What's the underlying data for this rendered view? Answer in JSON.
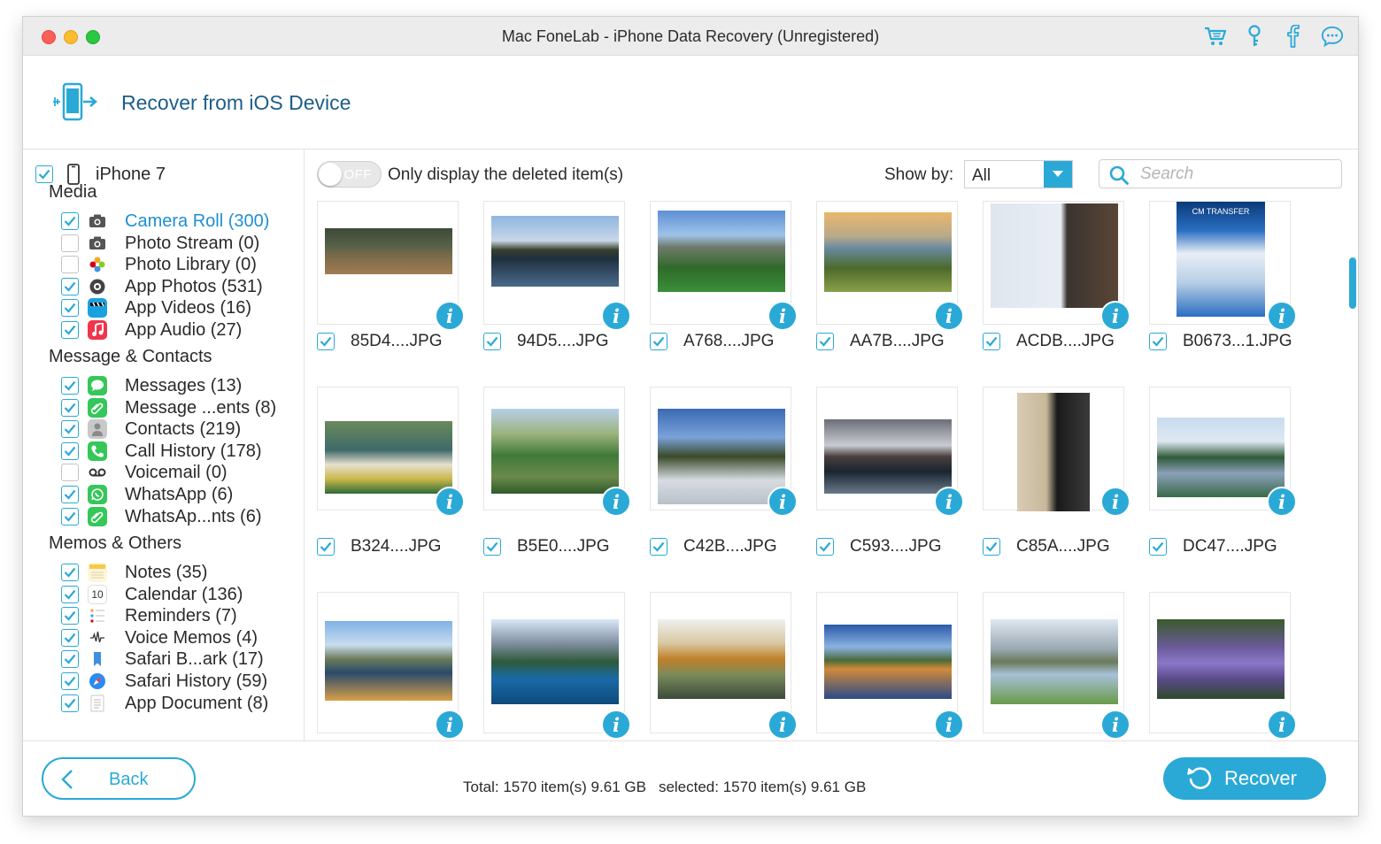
{
  "window": {
    "title": "Mac FoneLab - iPhone Data Recovery (Unregistered)",
    "toolbar_icons": [
      "cart-icon",
      "key-icon",
      "facebook-icon",
      "chat-icon"
    ]
  },
  "header": {
    "title": "Recover from iOS Device",
    "icon": "phone-transfer-icon"
  },
  "device": {
    "name": "iPhone 7",
    "checked": true
  },
  "sections": [
    {
      "title": "Media",
      "items": [
        {
          "label": "Camera Roll (300)",
          "checked": true,
          "icon": "camera-icon",
          "active": true
        },
        {
          "label": "Photo Stream (0)",
          "checked": false,
          "icon": "camera-icon"
        },
        {
          "label": "Photo Library (0)",
          "checked": false,
          "icon": "photos-flower-icon"
        },
        {
          "label": "App Photos (531)",
          "checked": true,
          "icon": "app-photos-icon"
        },
        {
          "label": "App Videos (16)",
          "checked": true,
          "icon": "clapperboard-icon"
        },
        {
          "label": "App Audio (27)",
          "checked": true,
          "icon": "music-note-icon"
        }
      ]
    },
    {
      "title": "Message & Contacts",
      "items": [
        {
          "label": "Messages (13)",
          "checked": true,
          "icon": "messages-icon"
        },
        {
          "label": "Message ...ents (8)",
          "checked": true,
          "icon": "paperclip-icon"
        },
        {
          "label": "Contacts (219)",
          "checked": true,
          "icon": "contacts-icon"
        },
        {
          "label": "Call History (178)",
          "checked": true,
          "icon": "phone-icon"
        },
        {
          "label": "Voicemail (0)",
          "checked": false,
          "icon": "voicemail-icon"
        },
        {
          "label": "WhatsApp (6)",
          "checked": true,
          "icon": "whatsapp-icon"
        },
        {
          "label": "WhatsAp...nts (6)",
          "checked": true,
          "icon": "whatsapp-attachment-icon"
        }
      ]
    },
    {
      "title": "Memos & Others",
      "items": [
        {
          "label": "Notes (35)",
          "checked": true,
          "icon": "notes-icon"
        },
        {
          "label": "Calendar (136)",
          "checked": true,
          "icon": "calendar-icon",
          "glyph": "10"
        },
        {
          "label": "Reminders (7)",
          "checked": true,
          "icon": "reminders-icon"
        },
        {
          "label": "Voice Memos (4)",
          "checked": true,
          "icon": "voice-memos-icon"
        },
        {
          "label": "Safari B...ark (17)",
          "checked": true,
          "icon": "bookmark-icon"
        },
        {
          "label": "Safari History (59)",
          "checked": true,
          "icon": "safari-compass-icon"
        },
        {
          "label": "App Document (8)",
          "checked": true,
          "icon": "document-icon"
        }
      ]
    }
  ],
  "filter": {
    "toggle_label": "OFF",
    "toggle_on": false,
    "toggle_text": "Only display the deleted item(s)",
    "show_by_label": "Show by:",
    "show_by_value": "All",
    "search_placeholder": "Search"
  },
  "photos": [
    {
      "name": "85D4....JPG",
      "checked": true
    },
    {
      "name": "94D5....JPG",
      "checked": true
    },
    {
      "name": "A768....JPG",
      "checked": true
    },
    {
      "name": "AA7B....JPG",
      "checked": true
    },
    {
      "name": "ACDB....JPG",
      "checked": true
    },
    {
      "name": "B0673...1.JPG",
      "checked": true
    },
    {
      "name": "B324....JPG",
      "checked": true
    },
    {
      "name": "B5E0....JPG",
      "checked": true
    },
    {
      "name": "C42B....JPG",
      "checked": true
    },
    {
      "name": "C593....JPG",
      "checked": true
    },
    {
      "name": "C85A....JPG",
      "checked": true
    },
    {
      "name": "DC47....JPG",
      "checked": true
    },
    {
      "name": "",
      "checked": true
    },
    {
      "name": "",
      "checked": true
    },
    {
      "name": "",
      "checked": true
    },
    {
      "name": "",
      "checked": true
    },
    {
      "name": "",
      "checked": true
    },
    {
      "name": "",
      "checked": true
    }
  ],
  "thumb_text": {
    "cm_transfer": "CM TRANSFER"
  },
  "info_glyph": "i",
  "footer": {
    "back_label": "Back",
    "total": "Total: 1570 item(s) 9.61 GB",
    "selected": "selected: 1570 item(s) 9.61 GB",
    "recover_label": "Recover"
  },
  "colors": {
    "accent": "#2ba9d6",
    "title_blue": "#1b5e8a",
    "active_link": "#1f8fd2"
  }
}
